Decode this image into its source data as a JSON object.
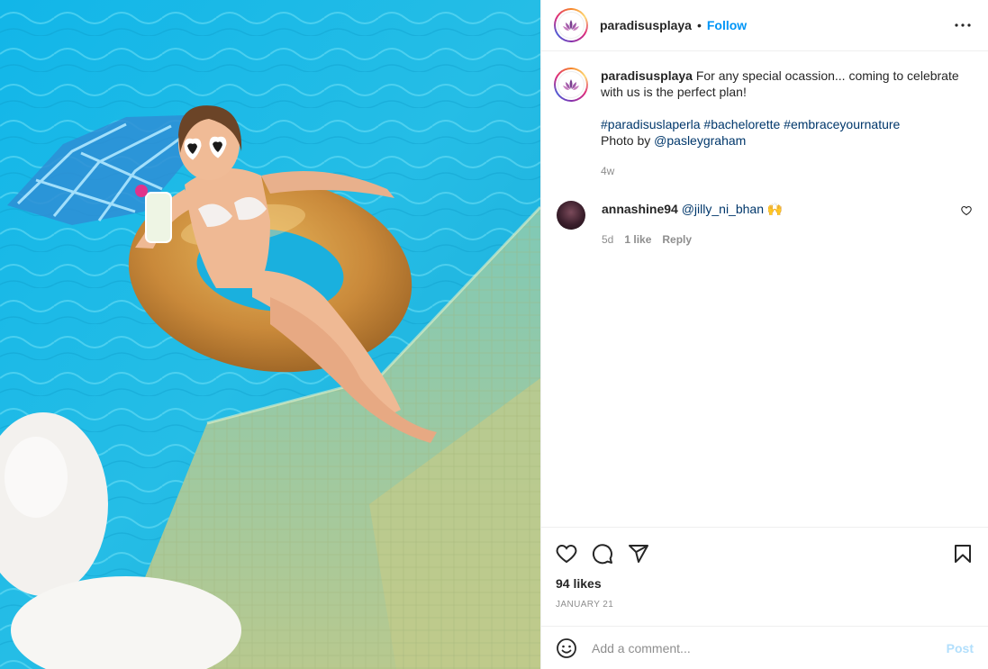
{
  "post": {
    "username": "paradisusplaya",
    "separator": "•",
    "follow_label": "Follow",
    "more_icon": "more-horizontal-icon",
    "caption": {
      "username": "paradisusplaya",
      "text": "For any special ocassion... coming to celebrate with us is the perfect plan!",
      "hashtags": [
        "#paradisuslaperla",
        "#bachelorette",
        "#embraceyournature"
      ],
      "credit_prefix": "Photo by ",
      "credit_handle": "@pasleygraham",
      "time": "4w"
    },
    "comments": [
      {
        "username": "annashine94",
        "mention": "@jilly_ni_bhan",
        "emoji": "🙌",
        "time": "5d",
        "likes": "1 like",
        "reply_label": "Reply"
      }
    ],
    "likes": "94 likes",
    "date": "JANUARY 21",
    "add_comment_placeholder": "Add a comment...",
    "post_label": "Post"
  },
  "colors": {
    "link_blue": "#0095f6",
    "tag_blue": "#00376b",
    "muted": "#8e8e8e",
    "post_disabled": "#b2dffc"
  }
}
